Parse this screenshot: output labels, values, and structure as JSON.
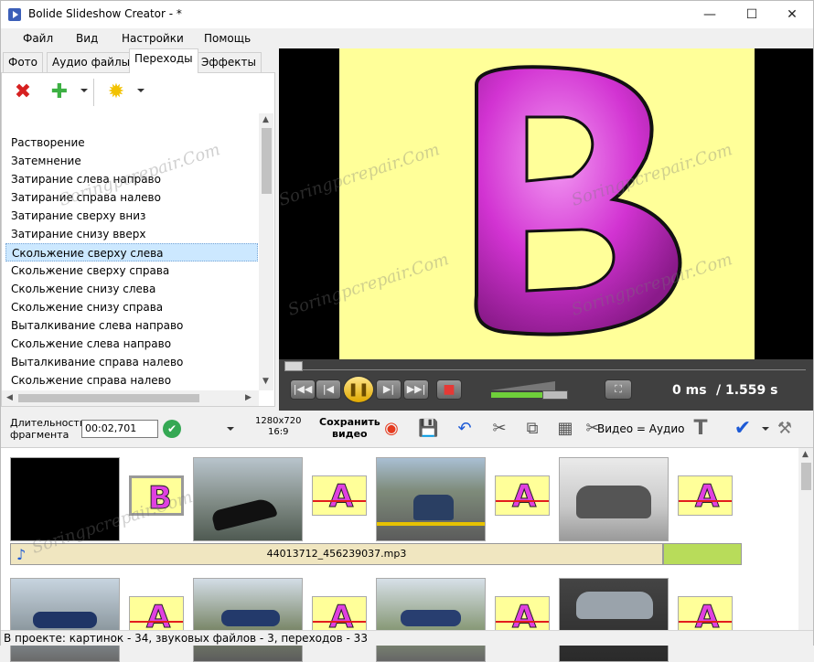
{
  "window": {
    "title": "Bolide Slideshow Creator - *"
  },
  "menu": [
    "Файл",
    "Вид",
    "Настройки",
    "Помощь"
  ],
  "tabs": [
    "Фото",
    "Аудио файлы",
    "Переходы",
    "Эффекты"
  ],
  "active_tab": "Переходы",
  "transitions": [
    "Растворение",
    "Затемнение",
    "Затирание слева направо",
    "Затирание справа налево",
    "Затирание сверху вниз",
    "Затирание снизу вверх",
    "Скольжение сверху слева",
    "Скольжение сверху справа",
    "Скольжение снизу слева",
    "Скольжение снизу справа",
    "Выталкивание слева направо",
    "Скольжение слева направо",
    "Выталкивание справа налево",
    "Скольжение справа налево"
  ],
  "selected_transition": "Скольжение сверху слева",
  "preview": {
    "letter": "B",
    "time_current": "0 ms",
    "time_total": "/ 1.559 s"
  },
  "toolbar": {
    "duration_label_1": "Длительность",
    "duration_label_2": "фрагмента",
    "duration_value": "00:02,701",
    "resolution": "1280x720",
    "aspect": "16:9",
    "save_1": "Сохранить",
    "save_2": "видео",
    "video_audio": "Видео = Аудио"
  },
  "timeline": {
    "transition_letters": [
      "B",
      "A",
      "A",
      "A",
      "A",
      "A",
      "A",
      "A"
    ],
    "audio_file": "44013712_456239037.mp3"
  },
  "watermark": "Soringpcrepair.Com",
  "status": "В проекте: картинок - 34, звуковых файлов - 3, переходов - 33"
}
